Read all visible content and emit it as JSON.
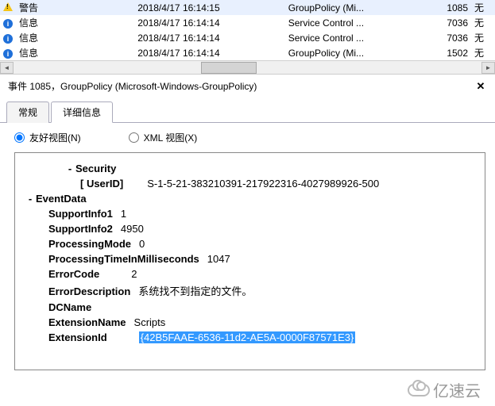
{
  "events": [
    {
      "level": "警告",
      "type": "warn",
      "time": "2018/4/17 16:14:15",
      "source": "GroupPolicy (Mi...",
      "id": "1085",
      "task": "无"
    },
    {
      "level": "信息",
      "type": "info",
      "time": "2018/4/17 16:14:14",
      "source": "Service Control ...",
      "id": "7036",
      "task": "无"
    },
    {
      "level": "信息",
      "type": "info",
      "time": "2018/4/17 16:14:14",
      "source": "Service Control ...",
      "id": "7036",
      "task": "无"
    },
    {
      "level": "信息",
      "type": "info",
      "time": "2018/4/17 16:14:14",
      "source": "GroupPolicy (Mi...",
      "id": "1502",
      "task": "无"
    }
  ],
  "detail_title": "事件 1085，GroupPolicy (Microsoft-Windows-GroupPolicy)",
  "close_label": "✕",
  "tabs": {
    "general": "常规",
    "details": "详细信息"
  },
  "radios": {
    "friendly": "友好视图(N)",
    "xml": "XML 视图(X)"
  },
  "tree": {
    "security": "Security",
    "userid_label": "[ UserID]",
    "userid_value": "S-1-5-21-383210391-217922316-4027989926-500",
    "eventdata": "EventData",
    "support1_k": "SupportInfo1",
    "support1_v": "1",
    "support2_k": "SupportInfo2",
    "support2_v": "4950",
    "procmode_k": "ProcessingMode",
    "procmode_v": "0",
    "proctime_k": "ProcessingTimeInMilliseconds",
    "proctime_v": "1047",
    "errcode_k": "ErrorCode",
    "errcode_v": "2",
    "errdesc_k": "ErrorDescription",
    "errdesc_v": "系统找不到指定的文件。",
    "dcname_k": "DCName",
    "dcname_v": "",
    "extname_k": "ExtensionName",
    "extname_v": "Scripts",
    "extid_k": "ExtensionId",
    "extid_v": "{42B5FAAE-6536-11d2-AE5A-0000F87571E3}"
  },
  "watermark": "亿速云"
}
